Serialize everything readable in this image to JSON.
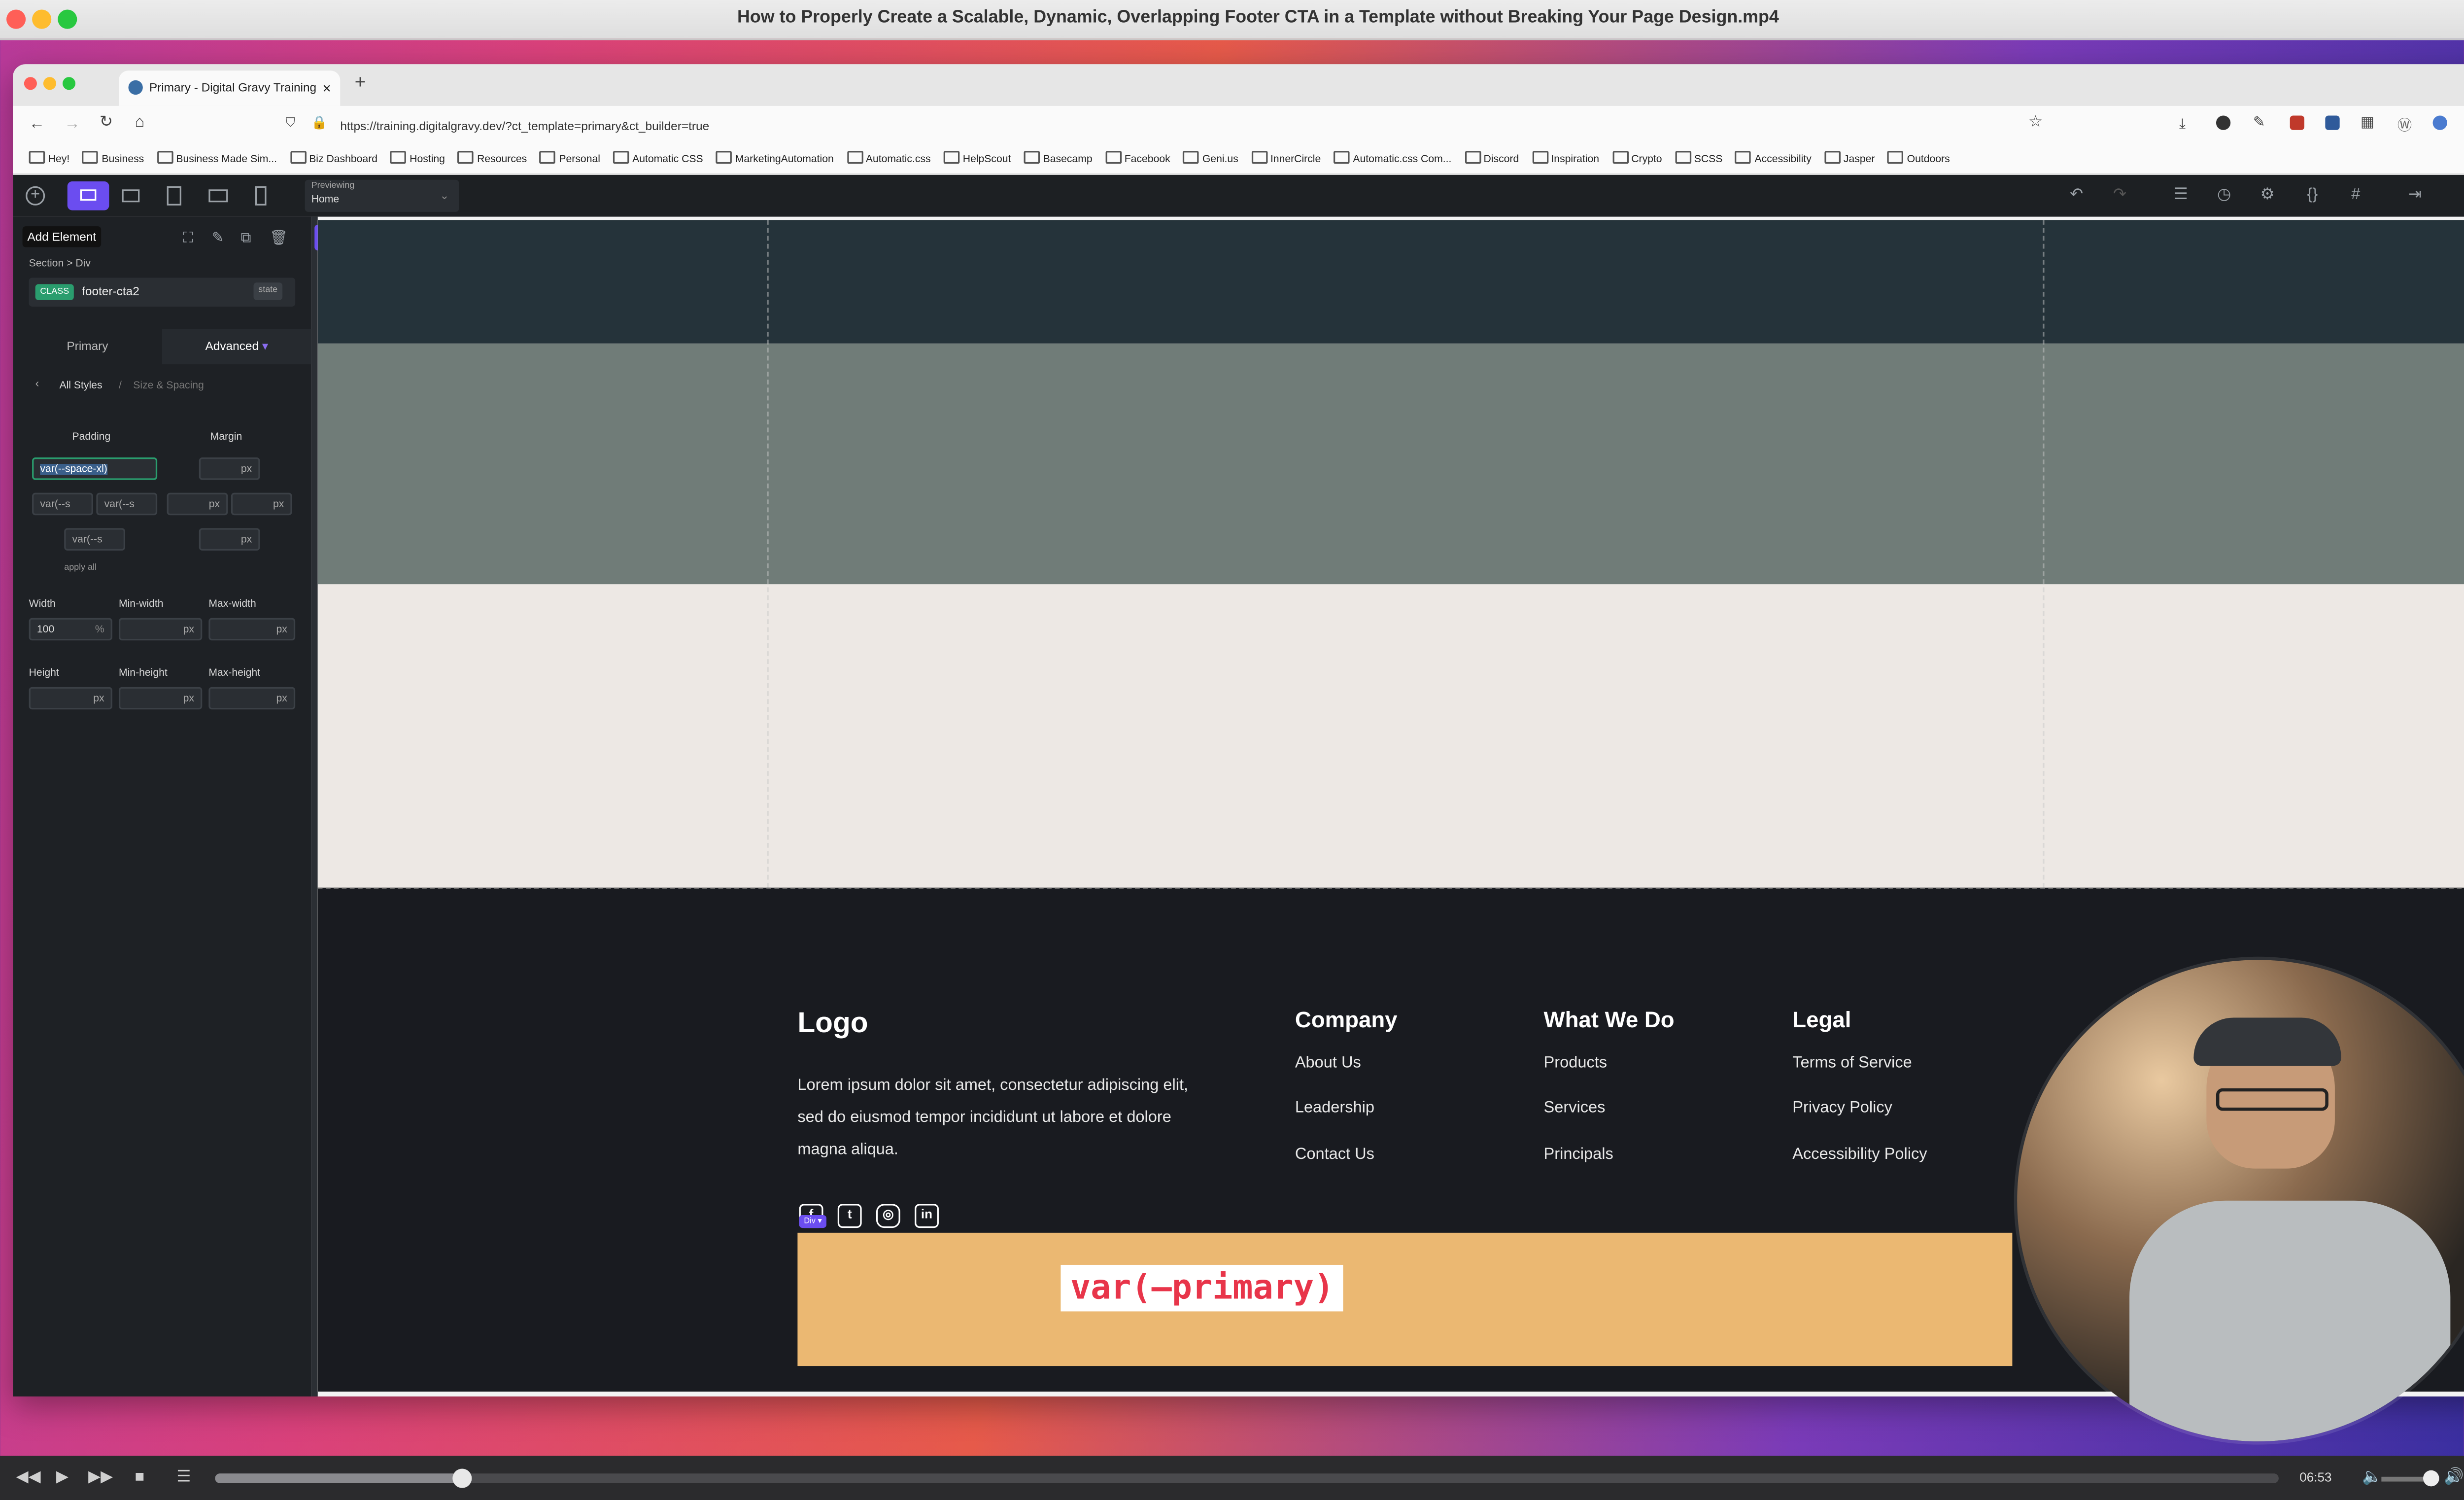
{
  "video": {
    "title": "How to Properly Create a Scalable, Dynamic, Overlapping Footer CTA in a Template without Breaking Your Page Design.mp4",
    "time": "06:53",
    "progress": 0.12
  },
  "browser": {
    "tab_title": "Primary - Digital Gravy Training",
    "url": "https://training.digitalgravy.dev/?ct_template=primary&ct_builder=true",
    "bookmarks": [
      "Hey!",
      "Business",
      "Business Made Sim...",
      "Biz Dashboard",
      "Hosting",
      "Resources",
      "Personal",
      "Automatic CSS",
      "MarketingAutomation",
      "Automatic.css",
      "HelpScout",
      "Basecamp",
      "Facebook",
      "Geni.us",
      "InnerCircle",
      "Automatic.css Com...",
      "Discord",
      "Inspiration",
      "Crypto",
      "SCSS",
      "Accessibility",
      "Jasper",
      "Outdoors"
    ]
  },
  "builder": {
    "previewing_label": "Previewing",
    "previewing_value": "Home",
    "add_element_label": "Add Element",
    "breadcrumb": "Section > Div",
    "class_badge": "CLASS",
    "class_name": "footer-cta2",
    "state_label": "state",
    "tabs": {
      "primary": "Primary",
      "advanced": "Advanced"
    },
    "styles_crumb": "All Styles",
    "styles_sub": "Size & Spacing",
    "padding_label": "Padding",
    "margin_label": "Margin",
    "padding_top": "var(--space-xl)",
    "padding_left": "var(--s",
    "padding_right": "var(--s",
    "padding_bottom": "var(--s",
    "unit_px": "px",
    "apply_all": "apply all",
    "width_label": "Width",
    "minwidth_label": "Min-width",
    "maxwidth_label": "Max-width",
    "width_value": "100",
    "width_unit": "%",
    "height_label": "Height",
    "minheight_label": "Min-height",
    "maxheight_label": "Max-height"
  },
  "footer": {
    "logo": "Logo",
    "description": "Lorem ipsum dolor sit amet, consectetur adipiscing elit, sed do eiusmod tempor incididunt ut labore et dolore magna aliqua.",
    "columns": [
      {
        "heading": "Company",
        "links": [
          "About Us",
          "Leadership",
          "Contact Us"
        ]
      },
      {
        "heading": "What We Do",
        "links": [
          "Products",
          "Services",
          "Principals"
        ]
      },
      {
        "heading": "Legal",
        "links": [
          "Terms of Service",
          "Privacy Policy",
          "Accessibility Policy"
        ]
      }
    ],
    "social_icons": [
      "facebook-icon",
      "twitter-icon",
      "instagram-icon",
      "linkedin-icon"
    ],
    "div_badge": "Div",
    "cta_text": "var(—primary)"
  },
  "colors": {
    "canvas_dark": "#25333a",
    "canvas_mid": "#707c78",
    "canvas_light": "#ede8e4",
    "footer_bg": "#191b20",
    "cta_bg": "#ebb872",
    "cta_text": "#e8354a",
    "accent": "#6b4df0"
  }
}
